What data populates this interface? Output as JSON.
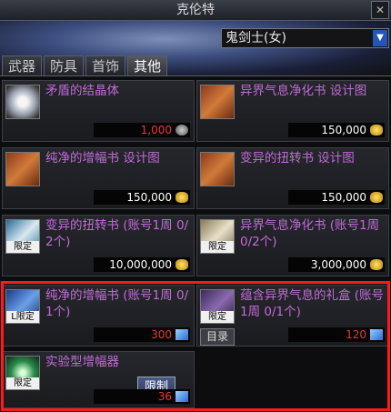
{
  "window": {
    "title": "克伦特",
    "close": "✕"
  },
  "class_select": {
    "value": "鬼剑士(女)",
    "arrow": "▼"
  },
  "tabs": [
    "武器",
    "防具",
    "首饰",
    "其他"
  ],
  "items": [
    {
      "name": "矛盾的结晶体",
      "price": "1,000",
      "currency": "silver-coin-icon"
    },
    {
      "name": "异界气息净化书 设计图",
      "price": "150,000",
      "currency": "gold-coin-icon"
    },
    {
      "name": "纯净的增幅书 设计图",
      "price": "150,000",
      "currency": "gold-coin-icon"
    },
    {
      "name": "变异的扭转书 设计图",
      "price": "150,000",
      "currency": "gold-coin-icon"
    },
    {
      "name": "变异的扭转书 (账号1周 0/2个)",
      "price": "10,000,000",
      "currency": "gold-coin-icon",
      "tag": "限定"
    },
    {
      "name": "异界气息净化书 (账号1周 0/2个)",
      "price": "3,000,000",
      "currency": "gold-coin-icon",
      "tag": "限定"
    },
    {
      "name": "纯净的增幅书 (账号1周 0/1个)",
      "price": "300",
      "currency": "blue-crystal-icon",
      "tag": "L限定"
    },
    {
      "name": "蕴含异界气息的礼盒 (账号1周 0/1个)",
      "price": "120",
      "currency": "blue-crystal-icon",
      "tag": "限定",
      "button": "目录"
    },
    {
      "name": "实验型增幅器",
      "price": "36",
      "currency": "blue-crystal-icon",
      "tag": "限定",
      "button": "限制"
    }
  ]
}
